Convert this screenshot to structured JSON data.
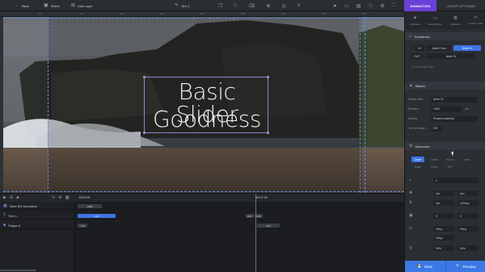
{
  "toolbar": {
    "back": "Back",
    "slides": "Slides",
    "add_layer": "Add Layer",
    "layer_title": "Text-1"
  },
  "panel_tabs": {
    "animation": "ANIMATION",
    "layer_options": "LAYER OPTIONS"
  },
  "panel_subtabs": [
    "Animation",
    "Responsivity",
    "Attributes",
    "Custom CSS"
  ],
  "ruler": [
    "50",
    "100",
    "150",
    "200",
    "250",
    "300",
    "350",
    "400",
    "450"
  ],
  "slide_text": {
    "line1": "Basic Slider",
    "line2": "Goodness"
  },
  "keyframes": {
    "title": "Keyframes",
    "in_label": "IN",
    "out_label": "OUT",
    "anim_from": "Anim From",
    "anim_to": "Anim To",
    "anim_to_2": "Anim To",
    "do_after": "Do on Slider Start"
  },
  "basics": {
    "title": "Basics",
    "rows": [
      {
        "label": "Frame Altas",
        "value": "Anim To"
      },
      {
        "label": "Duration",
        "value": "1000",
        "extra": "ms"
      },
      {
        "label": "Easing",
        "value": "Power4.easeOut"
      },
      {
        "label": "Text to Button",
        "value": "Off"
      }
    ]
  },
  "advanced": {
    "title": "Advanced",
    "tabs": [
      "Layer",
      "Chars",
      "Words",
      "Lines",
      "Mask",
      "Filter",
      "SFX"
    ],
    "values": [
      "0",
      "0px",
      "0px",
      "0px",
      "1000px",
      "0",
      "0",
      "0deg",
      "0deg",
      "0deg",
      "50%",
      "50%"
    ]
  },
  "timeline": {
    "editor_label": "EDITOR",
    "split_label": "SPLIT 00",
    "rows": [
      {
        "name": "Slide BG Animation",
        "bar": "1000"
      },
      {
        "name": "Text-1",
        "bar": "1000",
        "bar2": "OUT",
        "bar3": "300"
      },
      {
        "name": "Shape-0",
        "bar": "700",
        "bar2": "300"
      }
    ]
  },
  "actions": {
    "save": "Save",
    "preview": "Preview"
  },
  "colors": {
    "accent": "#6a41d8",
    "blue": "#3d73e6",
    "guide": "#5b8ff0"
  }
}
